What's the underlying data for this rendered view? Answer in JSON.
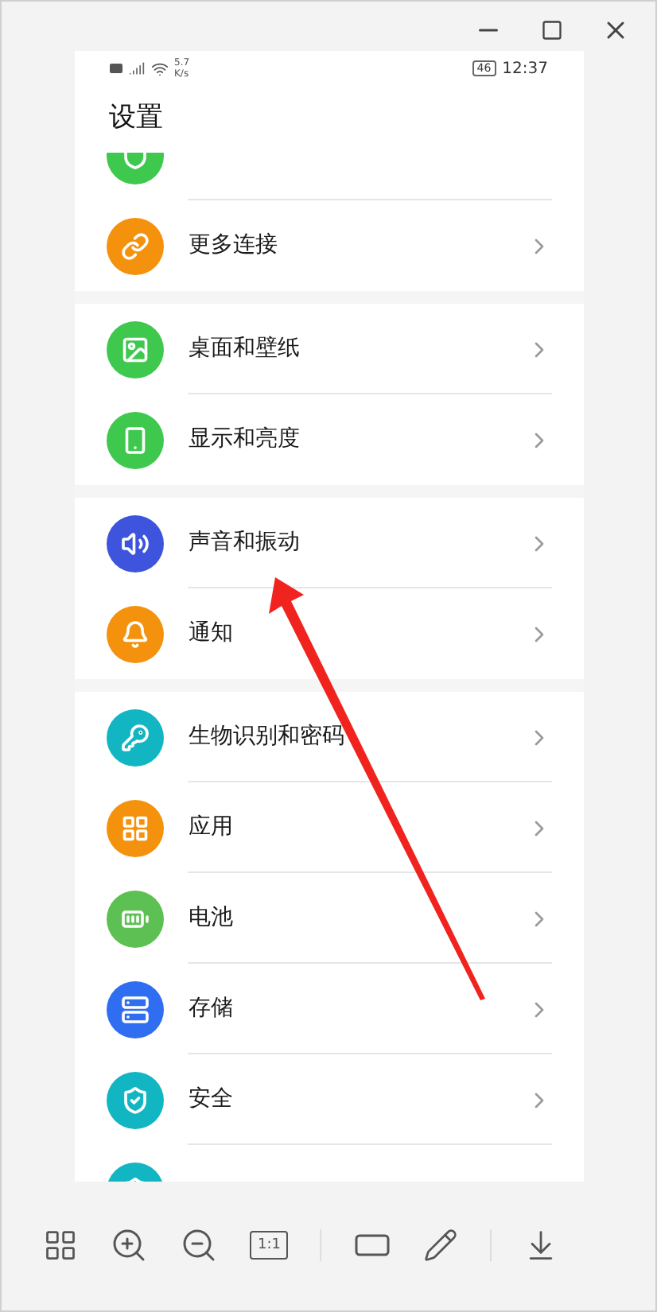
{
  "status_bar": {
    "network_speed": "5.7",
    "speed_unit": "K/s",
    "battery": "46",
    "time": "12:37"
  },
  "title": "设置",
  "groups": [
    {
      "items": [
        {
          "kind": "partial",
          "color": "#3ec84e"
        },
        {
          "kind": "row",
          "label": "更多连接",
          "color": "#f5920d"
        }
      ]
    },
    {
      "items": [
        {
          "kind": "row",
          "label": "桌面和壁纸",
          "color": "#3ec84e"
        },
        {
          "kind": "row",
          "label": "显示和亮度",
          "color": "#3ec84e"
        }
      ]
    },
    {
      "items": [
        {
          "kind": "row",
          "label": "声音和振动",
          "color": "#3e54dc"
        },
        {
          "kind": "row",
          "label": "通知",
          "color": "#f5920d"
        }
      ]
    },
    {
      "items": [
        {
          "kind": "row",
          "label": "生物识别和密码",
          "color": "#11b6c2"
        },
        {
          "kind": "row",
          "label": "应用",
          "color": "#f5920d"
        },
        {
          "kind": "row",
          "label": "电池",
          "color": "#5cc052"
        },
        {
          "kind": "row",
          "label": "存储",
          "color": "#2f6ef0"
        },
        {
          "kind": "row",
          "label": "安全",
          "color": "#11b6c2"
        },
        {
          "kind": "partial",
          "color": "#11b6c2"
        }
      ]
    }
  ],
  "toolbar": {
    "zoom_label": "1:1"
  }
}
